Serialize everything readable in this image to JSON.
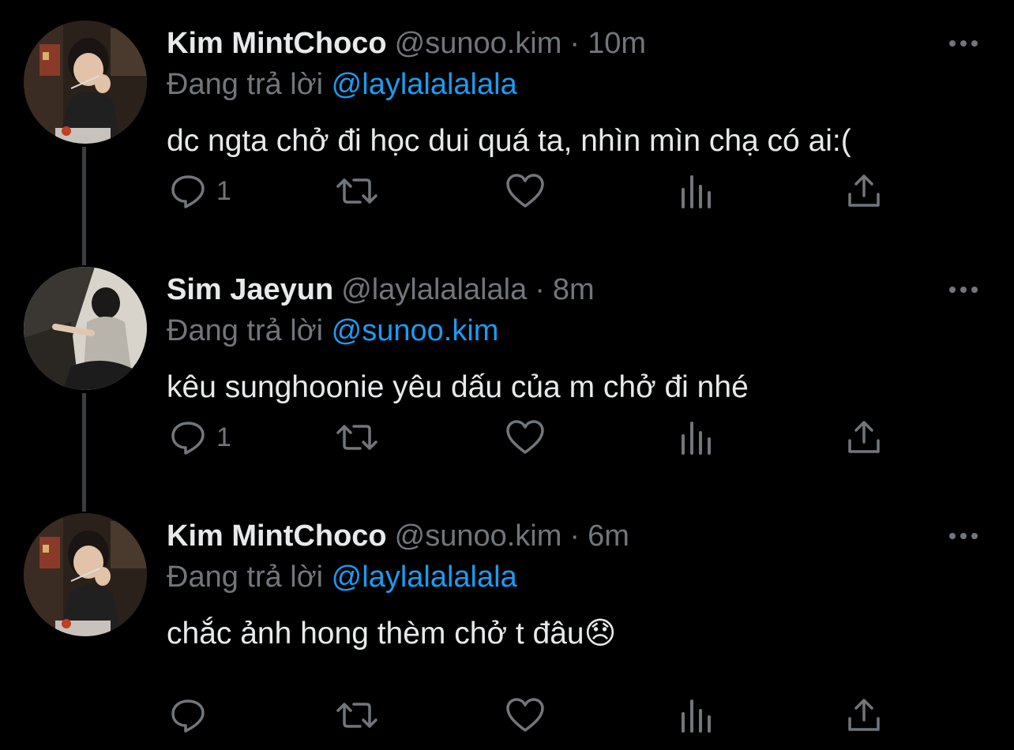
{
  "colors": {
    "background": "#000000",
    "text_primary": "#e7e9ea",
    "text_secondary": "#71767b",
    "link": "#1d9bf0",
    "thread_line": "#3a3d41"
  },
  "icons": {
    "reply": "speech-bubble-icon",
    "retweet": "retweet-arrows-icon",
    "like": "heart-icon",
    "views": "bar-chart-icon",
    "share": "share-upload-icon",
    "more": "three-dots-icon"
  },
  "tweets": [
    {
      "display_name": "Kim MintChoco",
      "handle": "@sunoo.kim",
      "separator": "·",
      "time": "10m",
      "reply_prefix": "Đang trả lời",
      "reply_to": "@laylalalalala",
      "text": "dc ngta chở đi học dui quá ta, nhìn mìn chạ có ai:(",
      "reply_count": "1"
    },
    {
      "display_name": "Sim Jaeyun",
      "handle": "@laylalalalala",
      "separator": "·",
      "time": "8m",
      "reply_prefix": "Đang trả lời",
      "reply_to": "@sunoo.kim",
      "text": "kêu sunghoonie yêu dấu của m chở đi nhé",
      "reply_count": "1"
    },
    {
      "display_name": "Kim MintChoco",
      "handle": "@sunoo.kim",
      "separator": "·",
      "time": "6m",
      "reply_prefix": "Đang trả lời",
      "reply_to": "@laylalalalala",
      "text": "chắc ảnh hong thèm chở t đâu😞",
      "reply_count": ""
    }
  ]
}
